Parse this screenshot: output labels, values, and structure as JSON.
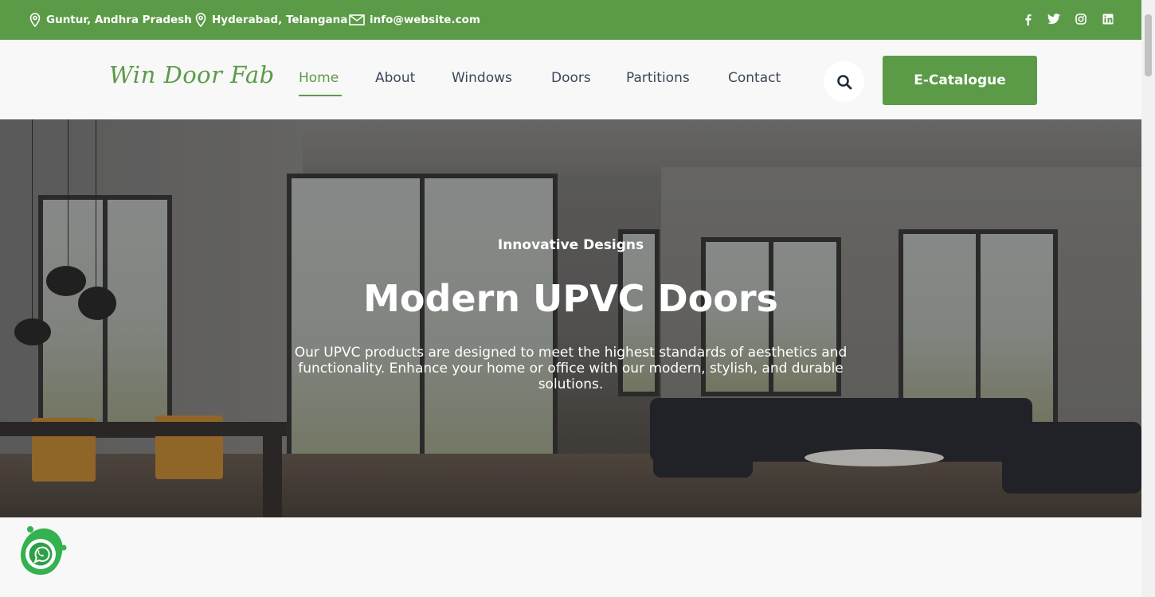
{
  "topbar": {
    "location1": "Guntur, Andhra Pradesh",
    "location2": "Hyderabad, Telangana",
    "email": "info@website.com",
    "background": "#5b9b47",
    "social": [
      "facebook-icon",
      "twitter-icon",
      "instagram-icon",
      "linkedin-icon"
    ]
  },
  "header": {
    "logo": "Win Door Fab",
    "nav": [
      {
        "label": "Home",
        "active": true
      },
      {
        "label": "About"
      },
      {
        "label": "Windows"
      },
      {
        "label": "Doors"
      },
      {
        "label": "Partitions"
      },
      {
        "label": "Contact"
      }
    ],
    "search_icon": "search-icon",
    "cta": "E-Catalogue"
  },
  "hero": {
    "subtitle": "Innovative Designs",
    "title": "Modern UPVC Doors",
    "description": "Our UPVC products are designed to meet the highest standards of aesthetics and functionality. Enhance your home or office with our modern, stylish, and durable solutions."
  },
  "colors": {
    "accent": "#5b9b47",
    "nav_text": "#3b4759"
  },
  "floating": {
    "icon": "whatsapp-icon"
  }
}
